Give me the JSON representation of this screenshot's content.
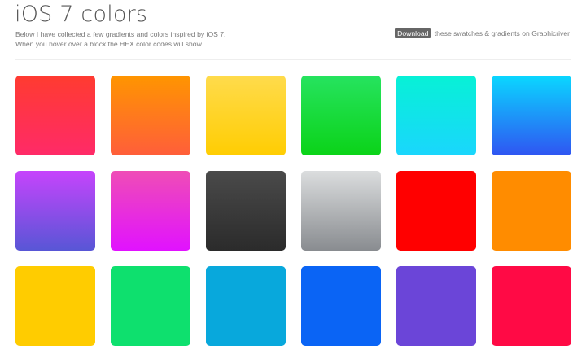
{
  "header": {
    "title": "iOS 7 colors",
    "intro_line_1": "Below I have collected a few gradients and colors inspired by iOS 7.",
    "intro_line_2": "When you hover over a block the HEX color codes will show.",
    "download_label": "Download",
    "download_rest": "these swatches & gradients on Graphicriver"
  },
  "swatches": [
    {
      "name": "red-gradient",
      "top": "#ff3b30",
      "bottom": "#ff2a68"
    },
    {
      "name": "orange-gradient",
      "top": "#ff9500",
      "bottom": "#ff5e3a"
    },
    {
      "name": "yellow-gradient",
      "top": "#ffdb4c",
      "bottom": "#ffcd02"
    },
    {
      "name": "green-gradient",
      "top": "#26e35f",
      "bottom": "#0bd318"
    },
    {
      "name": "teal-gradient",
      "top": "#07f1d6",
      "bottom": "#1ad6fd"
    },
    {
      "name": "blue-gradient",
      "top": "#0ad7ff",
      "bottom": "#2f55f2"
    },
    {
      "name": "violet-gradient",
      "top": "#c644fc",
      "bottom": "#5856d6"
    },
    {
      "name": "magenta-gradient",
      "top": "#ef4db6",
      "bottom": "#e112ff"
    },
    {
      "name": "black-gradient",
      "top": "#4a4a4a",
      "bottom": "#2b2b2b"
    },
    {
      "name": "silver-gradient",
      "top": "#dbddde",
      "bottom": "#898c90"
    },
    {
      "name": "red-solid",
      "top": "#ff0000",
      "bottom": "#ff0000"
    },
    {
      "name": "orange-solid",
      "top": "#ff8c00",
      "bottom": "#ff8c00"
    },
    {
      "name": "yellow-solid",
      "top": "#ffcc00",
      "bottom": "#ffcc00"
    },
    {
      "name": "green-solid",
      "top": "#0ee06e",
      "bottom": "#0ee06e"
    },
    {
      "name": "cyan-solid",
      "top": "#08a8dc",
      "bottom": "#08a8dc"
    },
    {
      "name": "blue-solid",
      "top": "#0a64f5",
      "bottom": "#0a64f5"
    },
    {
      "name": "purple-solid",
      "top": "#6b45d8",
      "bottom": "#6b45d8"
    },
    {
      "name": "pink-red-solid",
      "top": "#ff0a45",
      "bottom": "#ff0a45"
    }
  ]
}
